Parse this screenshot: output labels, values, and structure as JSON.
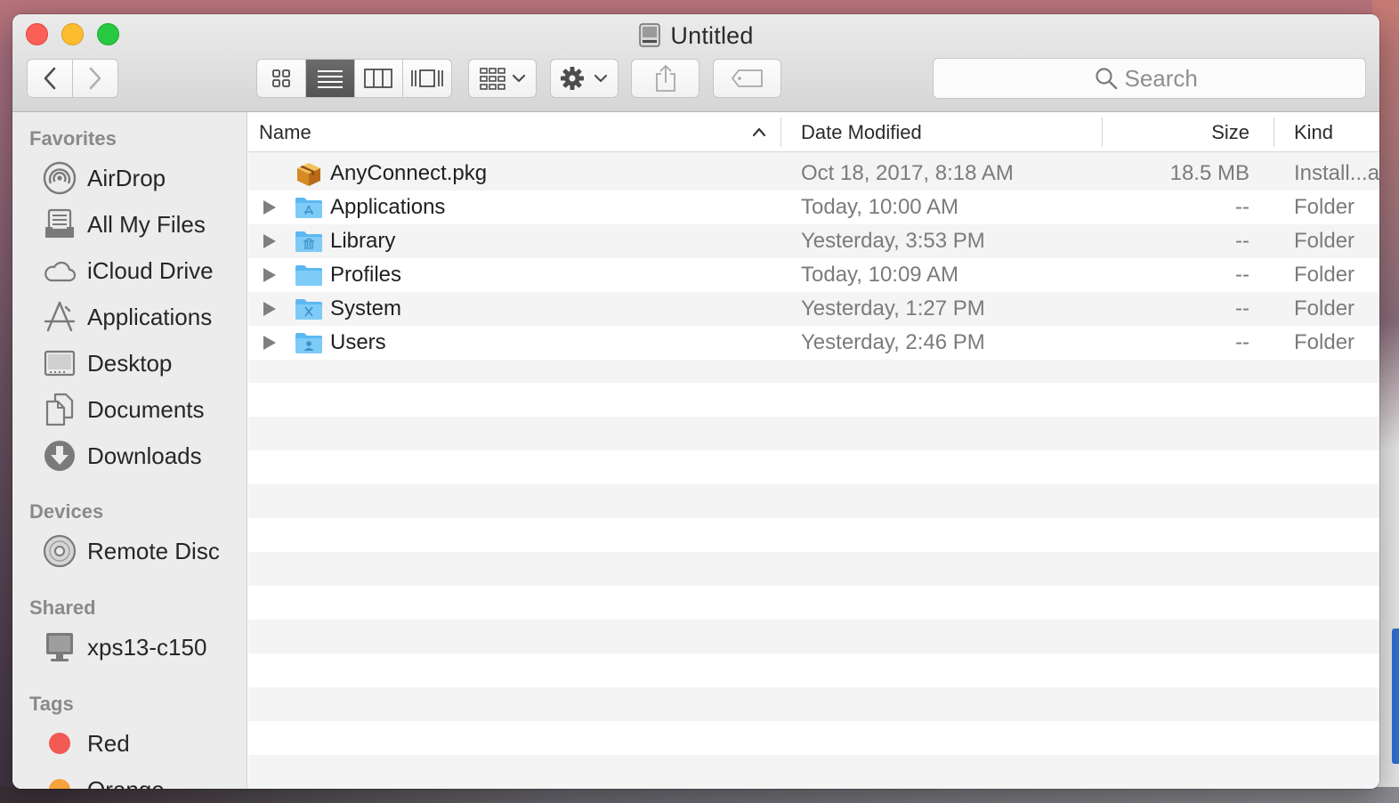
{
  "window": {
    "title": "Untitled"
  },
  "toolbar": {
    "search_placeholder": "Search"
  },
  "sidebar": {
    "favorites_header": "Favorites",
    "favorites": [
      {
        "label": "AirDrop",
        "icon": "airdrop-icon"
      },
      {
        "label": "All My Files",
        "icon": "all-files-icon"
      },
      {
        "label": "iCloud Drive",
        "icon": "cloud-icon"
      },
      {
        "label": "Applications",
        "icon": "applications-icon"
      },
      {
        "label": "Desktop",
        "icon": "desktop-icon"
      },
      {
        "label": "Documents",
        "icon": "documents-icon"
      },
      {
        "label": "Downloads",
        "icon": "downloads-icon"
      }
    ],
    "devices_header": "Devices",
    "devices": [
      {
        "label": "Remote Disc",
        "icon": "disc-icon"
      }
    ],
    "shared_header": "Shared",
    "shared": [
      {
        "label": "xps13-c150",
        "icon": "computer-icon"
      }
    ],
    "tags_header": "Tags",
    "tags": [
      {
        "label": "Red",
        "color": "#f25a54"
      },
      {
        "label": "Orange",
        "color": "#f5a33b"
      }
    ]
  },
  "columns": {
    "name": "Name",
    "date": "Date Modified",
    "size": "Size",
    "kind": "Kind"
  },
  "files": [
    {
      "name": "AnyConnect.pkg",
      "date": "Oct 18, 2017, 8:18 AM",
      "size": "18.5 MB",
      "kind": "Install...a",
      "icon": "package-icon",
      "expandable": false
    },
    {
      "name": "Applications",
      "date": "Today, 10:00 AM",
      "size": "--",
      "kind": "Folder",
      "icon": "applications-folder-icon",
      "expandable": true
    },
    {
      "name": "Library",
      "date": "Yesterday, 3:53 PM",
      "size": "--",
      "kind": "Folder",
      "icon": "library-folder-icon",
      "expandable": true
    },
    {
      "name": "Profiles",
      "date": "Today, 10:09 AM",
      "size": "--",
      "kind": "Folder",
      "icon": "folder-icon",
      "expandable": true
    },
    {
      "name": "System",
      "date": "Yesterday, 1:27 PM",
      "size": "--",
      "kind": "Folder",
      "icon": "system-folder-icon",
      "expandable": true
    },
    {
      "name": "Users",
      "date": "Yesterday, 2:46 PM",
      "size": "--",
      "kind": "Folder",
      "icon": "users-folder-icon",
      "expandable": true
    }
  ],
  "colors": {
    "accent": "#2f6fd3",
    "folder": "#5cb8f2",
    "close": "#fc5f57",
    "minimize": "#fdbc2e",
    "maximize": "#28c840"
  }
}
